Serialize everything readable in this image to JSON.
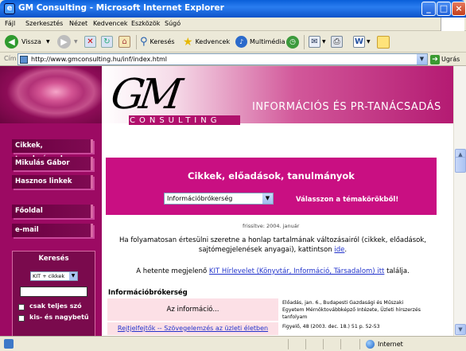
{
  "window": {
    "title": "GM Consulting - Microsoft Internet Explorer",
    "icon": "ie-icon",
    "min": "_",
    "max": "□",
    "close": "×"
  },
  "menu": [
    "Fájl",
    "Szerkesztés",
    "Nézet",
    "Kedvencek",
    "Eszközök",
    "Súgó"
  ],
  "toolbar": {
    "back": "Vissza",
    "search": "Keresés",
    "favorites": "Kedvencek",
    "media": "Multimédia"
  },
  "address": {
    "label": "Cím",
    "url": "http://www.gmconsulting.hu/inf/index.html",
    "go": "Ugrás"
  },
  "brand": {
    "logo": "GM",
    "consulting": "CONSULTING",
    "tagline": "INFORMÁCIÓS ÉS PR-TANÁCSADÁS"
  },
  "nav": [
    "Cikkek, tanulmányok",
    "Mikulás Gábor",
    "Hasznos linkek",
    "Főoldal",
    "e-mail"
  ],
  "search": {
    "heading": "Keresés",
    "scope": "KIT + cikkek",
    "query": "",
    "option1": "csak teljes szó",
    "option2": "kis- és nagybetű"
  },
  "content": {
    "title": "Cikkek, előadások, tanulmányok",
    "topic": "Információbrókerség",
    "choose": "Válasszon a témakörökből!",
    "updated": "frissítve: 2004. január",
    "intro1": "Ha folyamatosan értesülni szeretne a honlap tartalmának változásairól (cikkek, előadások,",
    "intro2": "sajtómegjelenések anyagai), kattintson",
    "intro_link": "ide",
    "weekly_pre": "A hetente megjelenő",
    "weekly_link": "KIT Hírlevelet (Könyvtár, Információ, Társadalom) itt",
    "weekly_post": "találja.",
    "section": "Információbrókerség",
    "row1_title": "Az információ...",
    "row1_meta1": "Előadás, jan. 6., Budapesti Gazdasági és Műszaki",
    "row1_meta2": "Egyetem Mérnöktovábbképző Intézete, Üzleti hírszerzés",
    "row1_meta3": "tanfolyam",
    "row2_title": "Rejtjelfejtők -- Szövegelemzés az üzleti életben",
    "row2_meta": "Figyelő, 48 (2003. dec. 18.) 51 p. 52-53"
  },
  "status": {
    "zone": "Internet"
  },
  "colors": {
    "magenta": "#c90f82",
    "dark_magenta": "#9c0a63",
    "xp_blue": "#0a5fd9"
  }
}
